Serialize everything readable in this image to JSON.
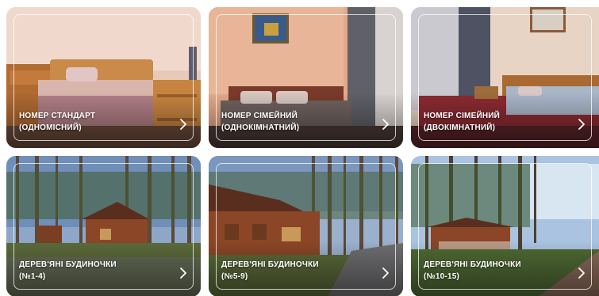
{
  "cards": [
    {
      "line1": "Номер стандарт",
      "line2": "(одномісний)"
    },
    {
      "line1": "Номер сімейний",
      "line2": "(однокімнатний)"
    },
    {
      "line1": "Номер сімейний",
      "line2": "(двокімнатний)"
    },
    {
      "line1": "Дерев'яні будиночки",
      "line2": "(№1-4)"
    },
    {
      "line1": "Дерев'яні будиночки",
      "line2": "(№5-9)"
    },
    {
      "line1": "Дерев'яні будиночки",
      "line2": "(№10-15)"
    }
  ],
  "icons": {
    "arrow": "chevron-right-icon"
  }
}
